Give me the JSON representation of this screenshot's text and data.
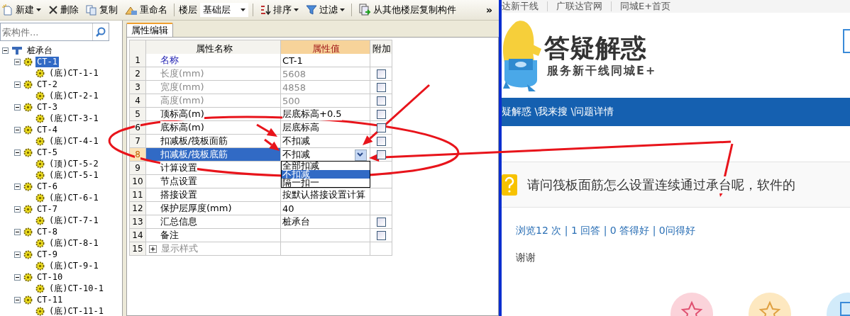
{
  "toolbar": {
    "items": [
      {
        "kind": "button",
        "label": "新建",
        "menu": true
      },
      {
        "kind": "button",
        "label": "删除",
        "menu": false
      },
      {
        "kind": "button",
        "label": "复制",
        "menu": false
      },
      {
        "kind": "button",
        "label": "重命名",
        "menu": false
      },
      {
        "kind": "separator"
      },
      {
        "kind": "label",
        "label": "楼层"
      },
      {
        "kind": "combo",
        "value": "基础层"
      },
      {
        "kind": "separator"
      },
      {
        "kind": "button",
        "label": "排序",
        "menu": true
      },
      {
        "kind": "button",
        "label": "过滤",
        "menu": true
      },
      {
        "kind": "separator"
      },
      {
        "kind": "button",
        "label": "从其他楼层复制构件",
        "menu": false
      },
      {
        "kind": "overflow",
        "label": "»"
      }
    ]
  },
  "search": {
    "placeholder": "索构件..."
  },
  "tree": [
    {
      "label": "桩承台",
      "selected": false,
      "expanded": true,
      "children": [
        {
          "label": "CT-1",
          "selected": true,
          "expanded": true,
          "children": [
            {
              "label": "(底)CT-1-1",
              "selected": false
            }
          ]
        },
        {
          "label": "CT-2",
          "selected": false,
          "expanded": true,
          "children": [
            {
              "label": "(底)CT-2-1",
              "selected": false
            }
          ]
        },
        {
          "label": "CT-3",
          "selected": false,
          "expanded": true,
          "children": [
            {
              "label": "(底)CT-3-1",
              "selected": false
            }
          ]
        },
        {
          "label": "CT-4",
          "selected": false,
          "expanded": true,
          "children": [
            {
              "label": "(底)CT-4-1",
              "selected": false
            }
          ]
        },
        {
          "label": "CT-5",
          "selected": false,
          "expanded": true,
          "children": [
            {
              "label": "(顶)CT-5-2",
              "selected": false
            },
            {
              "label": "(底)CT-5-1",
              "selected": false
            }
          ]
        },
        {
          "label": "CT-6",
          "selected": false,
          "expanded": true,
          "children": [
            {
              "label": "(底)CT-6-1",
              "selected": false
            }
          ]
        },
        {
          "label": "CT-7",
          "selected": false,
          "expanded": true,
          "children": [
            {
              "label": "(底)CT-7-1",
              "selected": false
            }
          ]
        },
        {
          "label": "CT-8",
          "selected": false,
          "expanded": true,
          "children": [
            {
              "label": "(底)CT-8-1",
              "selected": false
            }
          ]
        },
        {
          "label": "CT-9",
          "selected": false,
          "expanded": true,
          "children": [
            {
              "label": "(底)CT-9-1",
              "selected": false
            }
          ]
        },
        {
          "label": "CT-10",
          "selected": false,
          "expanded": true,
          "children": [
            {
              "label": "(底)CT-10-1",
              "selected": false
            }
          ]
        },
        {
          "label": "CT-11",
          "selected": false,
          "expanded": true,
          "children": [
            {
              "label": "(底)CT-11-1",
              "selected": false
            }
          ]
        }
      ]
    }
  ],
  "tabs": [
    {
      "label": "属性编辑",
      "selected": true
    }
  ],
  "grid": {
    "columns": [
      {
        "label": "属性名称",
        "selected": false
      },
      {
        "label": "属性值",
        "selected": true
      },
      {
        "label": "附加",
        "selected": false
      }
    ],
    "rows": [
      {
        "num": "1",
        "name": "名称",
        "value": "CT-1",
        "kind": "link",
        "selected": false
      },
      {
        "num": "2",
        "name": "长度(mm)",
        "value": "5608",
        "kind": "readonly",
        "selected": false,
        "checked": false
      },
      {
        "num": "3",
        "name": "宽度(mm)",
        "value": "4858",
        "kind": "readonly",
        "selected": false,
        "checked": false
      },
      {
        "num": "4",
        "name": "高度(mm)",
        "value": "500",
        "kind": "readonly",
        "selected": false,
        "checked": false
      },
      {
        "num": "5",
        "name": "顶标高(m)",
        "value": "层底标高+0.5",
        "kind": "normal",
        "selected": false,
        "checked": false
      },
      {
        "num": "6",
        "name": "底标高(m)",
        "value": "层底标高",
        "kind": "normal",
        "selected": false,
        "checked": false
      },
      {
        "num": "7",
        "name": "扣减板/筏板面筋",
        "value": "不扣减",
        "kind": "normal",
        "selected": false,
        "checked": false
      },
      {
        "num": "8",
        "name": "扣减板/筏板底筋",
        "value": "不扣减",
        "kind": "normal",
        "selected": true,
        "checked": false,
        "dropdown": {
          "open": true,
          "options": [
            {
              "label": "全部扣减",
              "selected": false
            },
            {
              "label": "不扣减",
              "selected": true
            },
            {
              "label": "隔一扣一",
              "selected": false
            }
          ]
        }
      },
      {
        "num": "9",
        "name": "计算设置",
        "kind": "normal",
        "selected": false
      },
      {
        "num": "10",
        "name": "节点设置",
        "kind": "normal",
        "selected": false
      },
      {
        "num": "11",
        "name": "搭接设置",
        "value": "按默认搭接设置计算",
        "kind": "normal",
        "selected": false
      },
      {
        "num": "12",
        "name": "保护层厚度(mm)",
        "value": "40",
        "kind": "normal",
        "selected": false
      },
      {
        "num": "13",
        "name": "汇总信息",
        "value": "桩承台",
        "kind": "normal",
        "selected": false,
        "checked": false
      },
      {
        "num": "14",
        "name": "备注",
        "kind": "normal",
        "selected": false,
        "checked": false
      },
      {
        "num": "15",
        "name": "显示样式",
        "kind": "group",
        "selected": false,
        "expanded": false
      }
    ]
  },
  "web": {
    "top_links": [
      "达新干线",
      "广联达官网",
      "同城E+首页"
    ],
    "logo_title": "答疑解惑",
    "logo_subtitle": "服务新干线同城E+",
    "breadcrumb": "疑解惑 \\我来搜 \\问题详情",
    "question": "请问筏板面筋怎么设置连续通过承台呢，软件的",
    "stats": "浏览12 次 | 1 回答 | 0 答得好 | 0问得好",
    "body": "谢谢"
  }
}
